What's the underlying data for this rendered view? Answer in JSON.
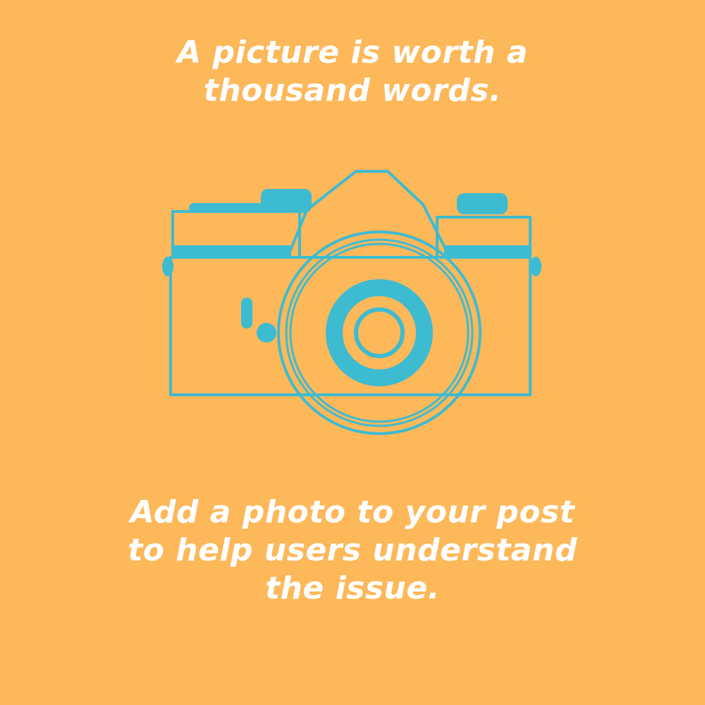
{
  "headline": {
    "line1": "A picture is worth a",
    "line2": "thousand words."
  },
  "caption": {
    "line1": "Add a photo to your post",
    "line2": "to help users understand",
    "line3": "the issue."
  },
  "illustration": {
    "icon": "camera-icon"
  },
  "colors": {
    "background": "#FDB85A",
    "text": "#FFFFFF",
    "camera": "#3DBBD1"
  }
}
